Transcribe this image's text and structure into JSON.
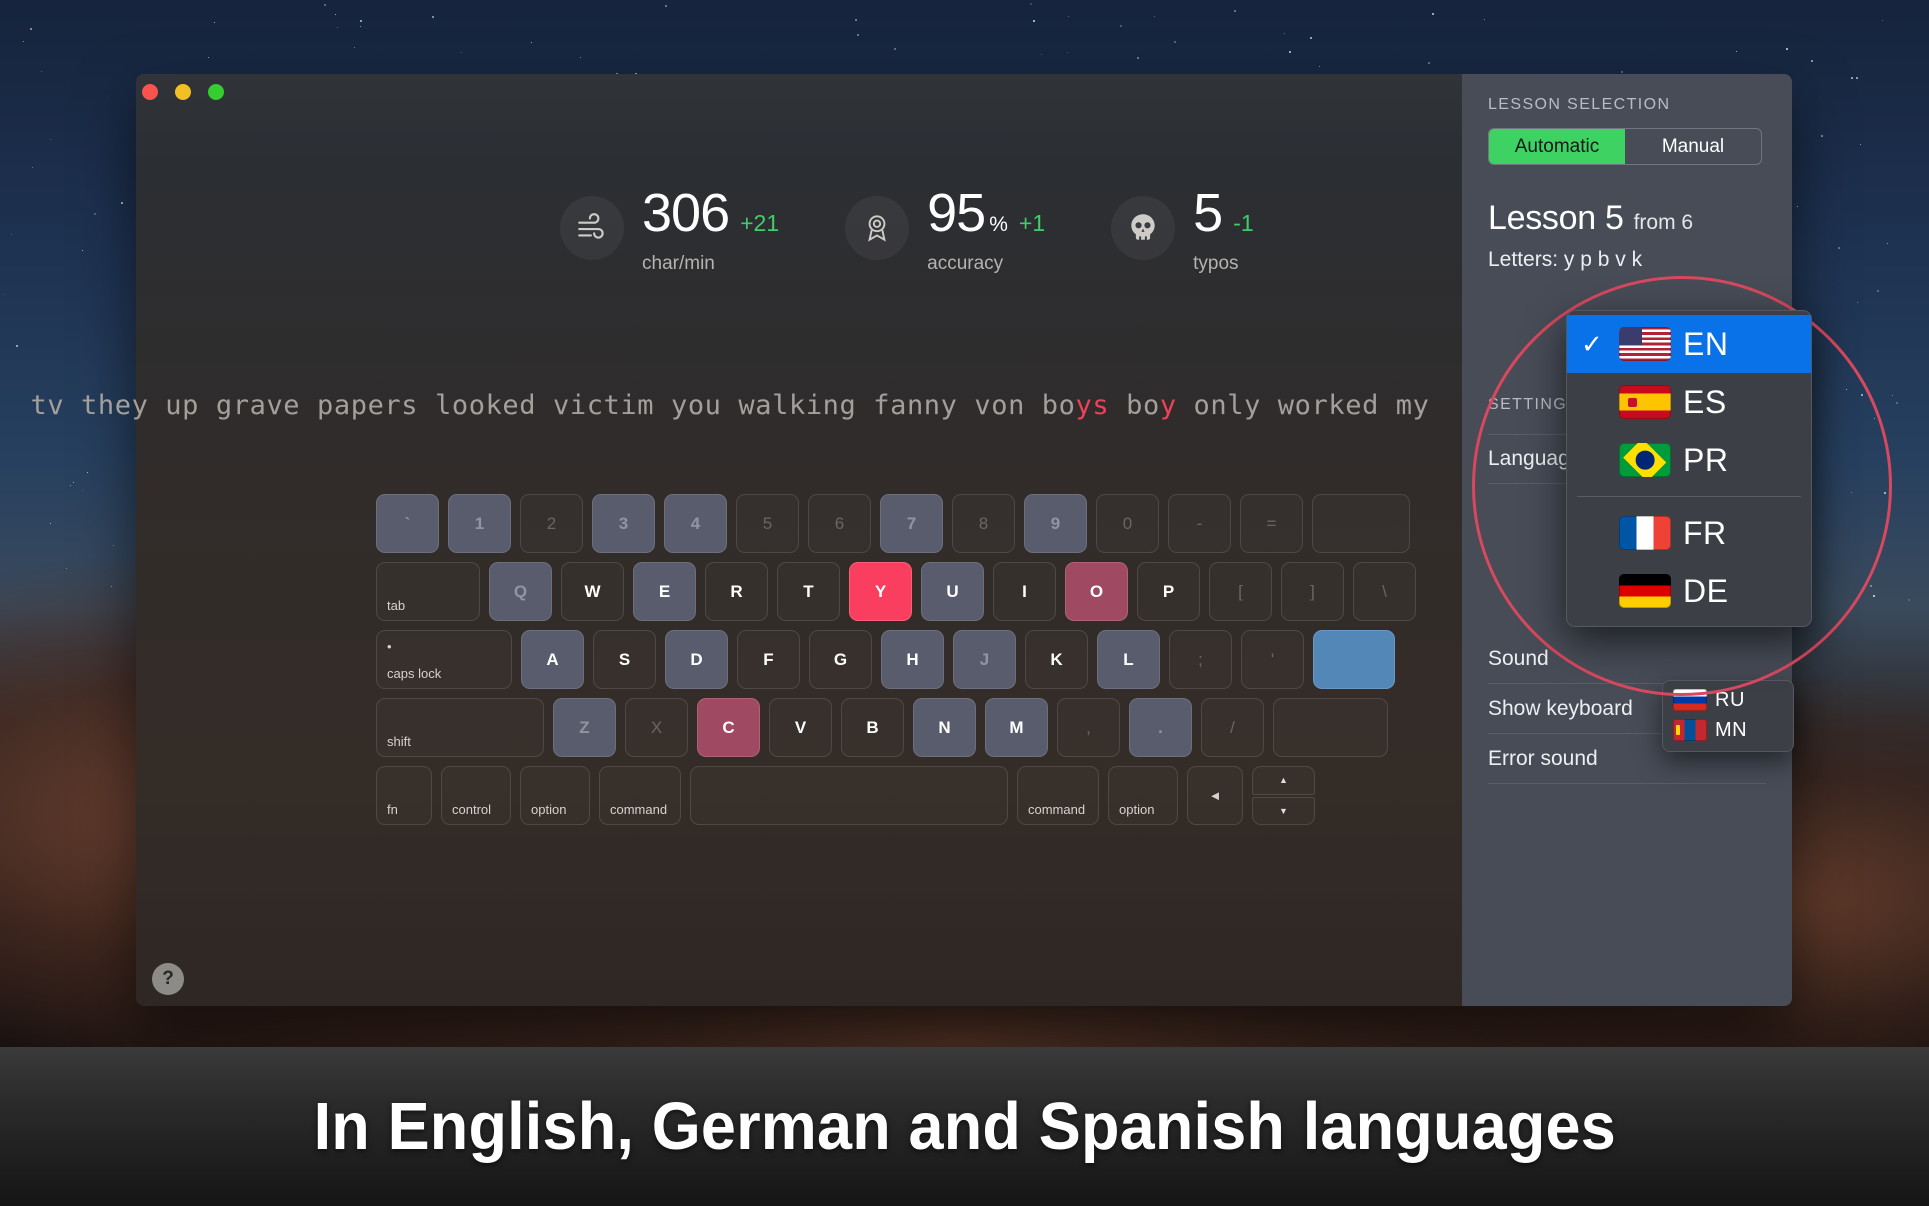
{
  "caption": {
    "text": "In English, German and Spanish languages"
  },
  "window": {
    "controls": [
      {
        "name": "close",
        "color": "#f8534f"
      },
      {
        "name": "minimize",
        "color": "#f2c024"
      },
      {
        "name": "zoom",
        "color": "#35cd2f"
      }
    ],
    "help_label": "?"
  },
  "stats": [
    {
      "icon": "wind-icon",
      "value": "306",
      "unit": "",
      "delta": "+21",
      "label": "char/min"
    },
    {
      "icon": "badge-icon",
      "value": "95",
      "unit": "%",
      "delta": "+1",
      "label": "accuracy"
    },
    {
      "icon": "skull-icon",
      "value": "5",
      "unit": "",
      "delta": "-1",
      "label": "typos"
    }
  ],
  "typing": {
    "segments": [
      {
        "text": "tv they up grave papers looked victim you walking fanny von bo",
        "error": false
      },
      {
        "text": "ys",
        "error": true
      },
      {
        "text": " bo",
        "error": false
      },
      {
        "text": "y",
        "error": true
      },
      {
        "text": " only worked my",
        "error": false
      }
    ]
  },
  "keyboard": {
    "rows": [
      [
        {
          "label": "`",
          "state": "hl",
          "w": "w1"
        },
        {
          "label": "1",
          "state": "hl",
          "w": "w1"
        },
        {
          "label": "2",
          "state": "dim",
          "w": "w1"
        },
        {
          "label": "3",
          "state": "hl",
          "w": "w1"
        },
        {
          "label": "4",
          "state": "hl",
          "w": "w1"
        },
        {
          "label": "5",
          "state": "dim",
          "w": "w1"
        },
        {
          "label": "6",
          "state": "dim",
          "w": "w1"
        },
        {
          "label": "7",
          "state": "hl",
          "w": "w1"
        },
        {
          "label": "8",
          "state": "dim",
          "w": "w1"
        },
        {
          "label": "9",
          "state": "hl",
          "w": "w1"
        },
        {
          "label": "0",
          "state": "dim",
          "w": "w1"
        },
        {
          "label": "-",
          "state": "dim",
          "w": "w1"
        },
        {
          "label": "=",
          "state": "dim",
          "w": "w1"
        },
        {
          "label": "",
          "state": "dim",
          "w": "w15"
        }
      ],
      [
        {
          "label": "tab",
          "state": "mod",
          "w": "wtab"
        },
        {
          "label": "Q",
          "state": "hl",
          "w": "w1"
        },
        {
          "label": "W",
          "state": "norm",
          "w": "w1"
        },
        {
          "label": "E",
          "state": "hl lit",
          "w": "w1"
        },
        {
          "label": "R",
          "state": "norm",
          "w": "w1"
        },
        {
          "label": "T",
          "state": "norm",
          "w": "w1"
        },
        {
          "label": "Y",
          "state": "active",
          "w": "w1"
        },
        {
          "label": "U",
          "state": "hl lit",
          "w": "w1"
        },
        {
          "label": "I",
          "state": "norm",
          "w": "w1"
        },
        {
          "label": "O",
          "state": "recent",
          "w": "w1"
        },
        {
          "label": "P",
          "state": "norm",
          "w": "w1"
        },
        {
          "label": "[",
          "state": "dim",
          "w": "w1"
        },
        {
          "label": "]",
          "state": "dim",
          "w": "w1"
        },
        {
          "label": "\\",
          "state": "dim",
          "w": "w1"
        }
      ],
      [
        {
          "label": "caps lock",
          "state": "caps",
          "w": "wcaps"
        },
        {
          "label": "A",
          "state": "hl lit",
          "w": "w1"
        },
        {
          "label": "S",
          "state": "norm",
          "w": "w1"
        },
        {
          "label": "D",
          "state": "hl lit",
          "w": "w1"
        },
        {
          "label": "F",
          "state": "norm",
          "w": "w1"
        },
        {
          "label": "G",
          "state": "norm",
          "w": "w1"
        },
        {
          "label": "H",
          "state": "hl lit",
          "w": "w1"
        },
        {
          "label": "J",
          "state": "hl",
          "w": "w1"
        },
        {
          "label": "K",
          "state": "norm",
          "w": "w1"
        },
        {
          "label": "L",
          "state": "hl lit",
          "w": "w1"
        },
        {
          "label": ";",
          "state": "dim",
          "w": "w1"
        },
        {
          "label": "'",
          "state": "dim",
          "w": "w1"
        },
        {
          "label": "",
          "state": "ret",
          "w": "w125"
        }
      ],
      [
        {
          "label": "shift",
          "state": "mod",
          "w": "wshift"
        },
        {
          "label": "Z",
          "state": "hl",
          "w": "w1"
        },
        {
          "label": "X",
          "state": "dim",
          "w": "w1"
        },
        {
          "label": "C",
          "state": "recent",
          "w": "w1"
        },
        {
          "label": "V",
          "state": "norm",
          "w": "w1"
        },
        {
          "label": "B",
          "state": "norm",
          "w": "w1"
        },
        {
          "label": "N",
          "state": "hl lit",
          "w": "w1"
        },
        {
          "label": "M",
          "state": "hl lit",
          "w": "w1"
        },
        {
          "label": ",",
          "state": "dim",
          "w": "w1"
        },
        {
          "label": ".",
          "state": "hl",
          "w": "w1"
        },
        {
          "label": "/",
          "state": "dim",
          "w": "w1"
        },
        {
          "label": "",
          "state": "dim",
          "w": "w175"
        }
      ],
      [
        {
          "label": "fn",
          "state": "mod",
          "w": "wmod"
        },
        {
          "label": "control",
          "state": "mod",
          "w": "wmod2"
        },
        {
          "label": "option",
          "state": "mod",
          "w": "wmod2"
        },
        {
          "label": "command",
          "state": "mod",
          "w": "w125"
        },
        {
          "label": "",
          "state": "norm",
          "w": "wsp"
        },
        {
          "label": "command",
          "state": "mod",
          "w": "w125"
        },
        {
          "label": "option",
          "state": "mod",
          "w": "wmod2"
        },
        {
          "label": "◄",
          "state": "modc",
          "w": "wmod"
        },
        {
          "label": "arrows",
          "state": "arrows",
          "w": "w1"
        }
      ]
    ]
  },
  "sidebar": {
    "lesson_section_title": "LESSON SELECTION",
    "mode_automatic": "Automatic",
    "mode_manual": "Manual",
    "mode_selected": "Automatic",
    "lesson_title": "Lesson 5",
    "lesson_from": "from 6",
    "lesson_letters": "Letters: y p b v k",
    "settings_title": "SETTINGS",
    "settings_rows": [
      {
        "label": "Language"
      },
      {
        "label": "Sound"
      },
      {
        "label": "Show keyboard"
      },
      {
        "label": "Error sound"
      }
    ]
  },
  "language_menu": {
    "selected": "EN",
    "items": [
      {
        "code": "EN",
        "flag": "f-us",
        "checked": true
      },
      {
        "code": "ES",
        "flag": "f-es",
        "checked": false
      },
      {
        "code": "PR",
        "flag": "f-br",
        "checked": false
      },
      {
        "code": "SEP",
        "flag": "",
        "checked": false
      },
      {
        "code": "FR",
        "flag": "f-fr",
        "checked": false
      },
      {
        "code": "DE",
        "flag": "f-de",
        "checked": false
      }
    ],
    "check_glyph": "✓",
    "overflow_items": [
      {
        "code": "RU",
        "flag": "f-ru"
      },
      {
        "code": "MN",
        "flag": "f-mn"
      }
    ]
  },
  "colors": {
    "accent_green": "#3ed263",
    "active_key": "#fa3e5f",
    "recent_key": "#9f4a62",
    "return_key": "#5287b8",
    "highlight_key": "#585c6d",
    "menu_selected": "#0a72e8",
    "ring": "#d8485e",
    "delta_green": "#3ecf6a"
  }
}
